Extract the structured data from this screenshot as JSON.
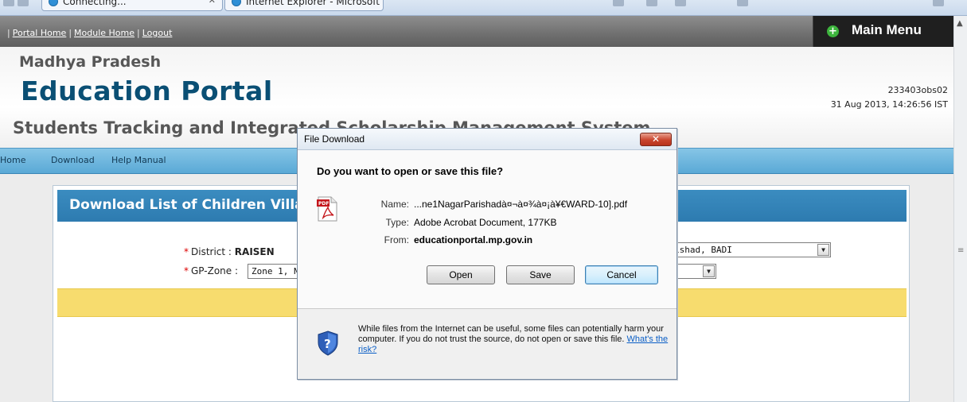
{
  "browser": {
    "tabs": [
      {
        "label": "Connecting..."
      },
      {
        "label": "Internet Explorer - Microsoft"
      }
    ]
  },
  "topbar": {
    "links": [
      "Portal Home",
      "Module Home",
      "Logout"
    ],
    "main_menu_label": "Main Menu"
  },
  "header": {
    "state": "Madhya Pradesh",
    "portal_name": "Education Portal",
    "system_name": "Students Tracking and Integrated Scholarship Management System",
    "user_id": "233403obs02",
    "datetime": "31 Aug 2013, 14:26:56 IST"
  },
  "nav": {
    "items": [
      "Home",
      "Download",
      "Help Manual"
    ]
  },
  "panel": {
    "title": "Download List of Children Village",
    "district_label": "District :",
    "district_value": "RAISEN",
    "gpzone_label": "GP-Zone :",
    "gpzone_value": "Zone 1, N",
    "right_select_value": "ishad, BADI",
    "required_mark": "*"
  },
  "dialog": {
    "title": "File Download",
    "question": "Do you want to open or save this file?",
    "name_label": "Name:",
    "name_value": "...ne1NagarParishadà¤¬à¤¾à¤¡à¥€WARD-10].pdf",
    "type_label": "Type:",
    "type_value": "Adobe Acrobat Document, 177KB",
    "from_label": "From:",
    "from_value": "educationportal.mp.gov.in",
    "open_label": "Open",
    "save_label": "Save",
    "cancel_label": "Cancel",
    "warning_text": "While files from the Internet can be useful, some files can potentially harm your computer. If you do not trust the source, do not open or save this file.",
    "risk_link": "What's the risk?"
  },
  "icons": {
    "pdf": "pdf-file-icon",
    "shield": "security-shield-icon",
    "plus": "plus-circle-icon",
    "close": "close-icon",
    "dropdown": "chevron-down-icon"
  },
  "colors": {
    "portal_blue": "#0a4f74",
    "nav_blue": "#5aa9d6",
    "panel_title_blue": "#2d7bb0",
    "highlight_yellow": "#f7dc6e",
    "main_menu_bg": "#1f1f1f"
  }
}
